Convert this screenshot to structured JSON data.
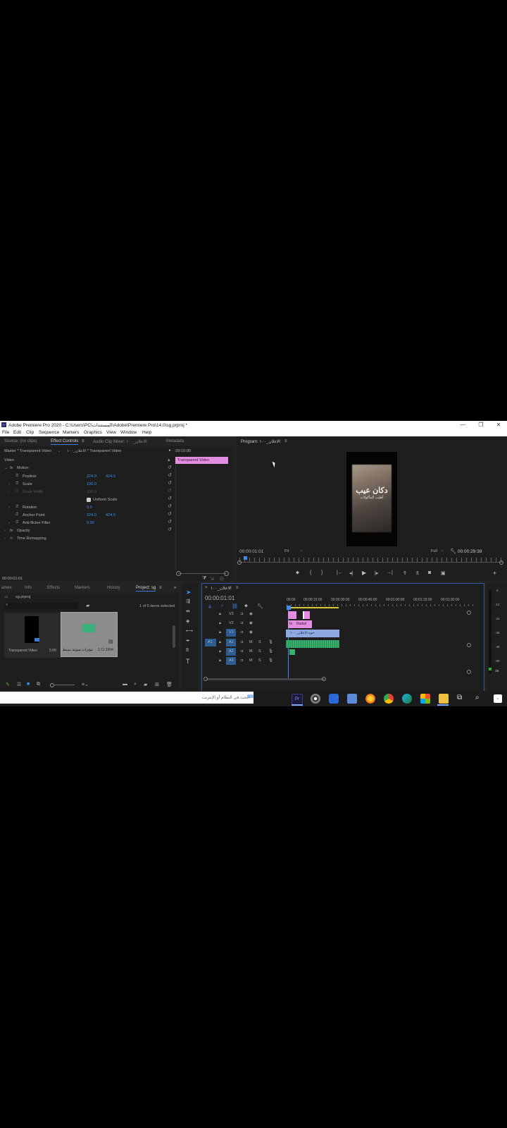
{
  "window": {
    "title": "Adobe Premiere Pro 2020 - C:\\Users\\PC\\المستندات\\Adobe\\Premiere Pro\\14.0\\sg.prproj *",
    "controls": [
      "—",
      "❐",
      "✕"
    ]
  },
  "menu": [
    "File",
    "Edit",
    "Clip",
    "Sequence",
    "Markers",
    "Graphics",
    "View",
    "Window",
    "Help"
  ],
  "source_tabs": {
    "tabs": [
      "Source: (no clips)",
      "Effect Controls",
      "Audio Clip Mixer: الاعلان_١٠٠",
      "Metadata"
    ],
    "active": "Effect Controls"
  },
  "effect_controls": {
    "master_label": "Master * Transparent Video",
    "sequence_label": "الاعلان_١٠٠ * Transparent Video",
    "timecode_top": ":00:10:00",
    "clip_bar_label": "Transparent Video",
    "section": "Video",
    "motion": "Motion",
    "position_label": "Position",
    "position_x": "224.0",
    "position_y": "424.0",
    "scale_label": "Scale",
    "scale_value": "100.0",
    "scale_width_label": "Scale Width",
    "scale_width_value": "100.0",
    "uniform_scale": "Uniform Scale",
    "rotation_label": "Rotation",
    "rotation_value": "0.0",
    "anchor_label": "Anchor Point",
    "anchor_x": "224.0",
    "anchor_y": "424.0",
    "antiflicker_label": "Anti-flicker Filter",
    "antiflicker_value": "0.00",
    "opacity": "Opacity",
    "time_remap": "Time Remapping",
    "timecode_bottom": "00:00:01:01"
  },
  "program": {
    "tab_label": "Program: الاعلان_١٠٠",
    "overlay_title": "دكان عيب",
    "overlay_sub": "أطيب المأكولات",
    "timecode": "00:00:01:01",
    "fit": "Fit",
    "quality": "Full",
    "duration": "00:00:29:39"
  },
  "project_tabs": {
    "tabs": [
      "ames",
      "Info",
      "Effects",
      "Markers",
      "History",
      "Project: sg"
    ],
    "active": "Project: sg"
  },
  "project": {
    "file": "sg.prproj",
    "selection_info": "1 of 5 items selected",
    "items": [
      {
        "name": "Transparent Video",
        "duration": "5:00"
      },
      {
        "name": "مؤثرات صوتية بسيط",
        "duration": "1:11:1904"
      }
    ]
  },
  "timeline": {
    "tab_label": "الاعلان_١٠٠",
    "timecode": "00:00:01:01",
    "ruler": [
      "00:00",
      "00:00:15:00",
      "00:00:30:00",
      "00:00:45:00",
      "00:01:00:00",
      "00:01:15:00",
      "00:01:30:00"
    ],
    "tracks": [
      {
        "source": "",
        "name": "V3"
      },
      {
        "source": "",
        "name": "V2"
      },
      {
        "source": "",
        "name": "V1"
      },
      {
        "source": "A1",
        "name": "A1"
      },
      {
        "source": "",
        "name": "A2"
      },
      {
        "source": "",
        "name": "A3"
      }
    ],
    "clip_v2": "Radial",
    "clip_v1": "خوه الاعلان_١٠٠"
  },
  "meter_labels": [
    "0",
    "-12",
    "-24",
    "-36",
    "-48",
    "-60",
    "dB"
  ],
  "taskbar": {
    "search_placeholder": "ابحث في النظام أو الإنترنت",
    "apps": [
      "Pr",
      "Chrome",
      "Shield",
      "Calc",
      "Firefox",
      "Chrome",
      "Edge",
      "Store",
      "Folder",
      "Tasks",
      "Search",
      "Windows"
    ]
  },
  "colors": {
    "accent_blue": "#3b8ef0",
    "clip_pink": "#e38de0",
    "clip_blue": "#8fa9e0",
    "audio_green": "#36b06b"
  }
}
